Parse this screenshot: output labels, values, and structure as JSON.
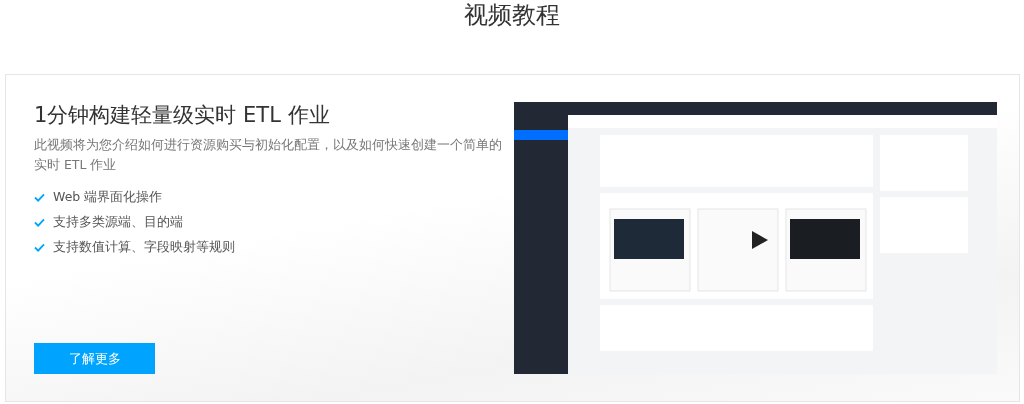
{
  "page_title": "视频教程",
  "tutorial": {
    "title": "1分钟构建轻量级实时 ETL 作业",
    "description": "此视频将为您介绍如何进行资源购买与初始化配置，以及如何快速创建一个简单的实时 ETL 作业",
    "features": [
      "Web 端界面化操作",
      "支持多类源端、目的端",
      "支持数值计算、字段映射等规则"
    ],
    "button": "了解更多"
  }
}
